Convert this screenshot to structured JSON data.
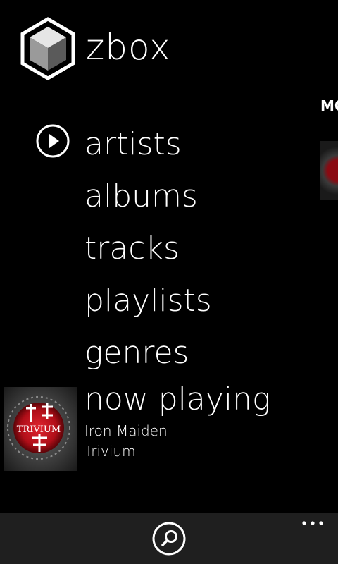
{
  "app": {
    "name": "zbox",
    "logo_icon": "hexagon-cube-logo"
  },
  "peek_panel": {
    "label": "MO"
  },
  "menu": {
    "items": [
      {
        "label": "artists"
      },
      {
        "label": "albums"
      },
      {
        "label": "tracks"
      },
      {
        "label": "playlists"
      },
      {
        "label": "genres"
      }
    ]
  },
  "now_playing": {
    "label": "now playing",
    "artist": "Iron Maiden",
    "track": "Trivium",
    "album_art_text": "TRIVIUM"
  },
  "app_bar": {
    "search_icon": "search-icon",
    "more_icon": "more-dots-icon"
  },
  "colors": {
    "background": "#000000",
    "text": "#ffffff",
    "app_bar": "#1f1f1f",
    "album_accent": "#c0101a"
  }
}
